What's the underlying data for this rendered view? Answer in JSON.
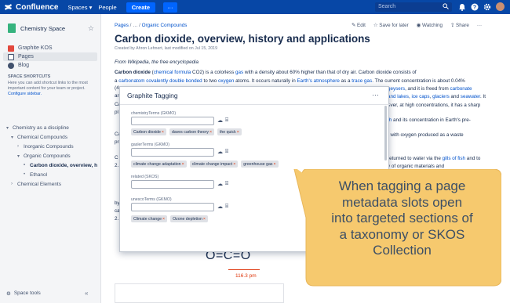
{
  "topbar": {
    "app_name": "Confluence",
    "spaces": "Spaces",
    "spaces_caret": "▾",
    "people": "People",
    "create": "Create",
    "more": "···",
    "search_placeholder": "Search"
  },
  "sidebar": {
    "space_name": "Chemistry Space",
    "items": [
      {
        "label": "Graphite KOS"
      },
      {
        "label": "Pages"
      },
      {
        "label": "Blog"
      }
    ],
    "shortcuts_heading": "SPACE SHORTCUTS",
    "shortcuts_text": "Here you can add shortcut links to the most important content for your team or project.",
    "shortcuts_link": "Configure sidebar.",
    "tree": [
      {
        "label": "Chemistry as a discipline",
        "caret": "▾"
      },
      {
        "label": "Chemical Compounds",
        "caret": "▾"
      },
      {
        "label": "Inorganic Compounds",
        "caret": "›"
      },
      {
        "label": "Organic Compounds",
        "caret": "▾"
      },
      {
        "label": "Carbon dioxide, overview, h",
        "caret": "•"
      },
      {
        "label": "Ethanol",
        "caret": "•"
      },
      {
        "label": "Chemical Elements",
        "caret": "›"
      }
    ],
    "space_tools": "Space tools",
    "collapse": "«"
  },
  "page": {
    "breadcrumb_root": "Pages",
    "breadcrumb_sep": " / … /",
    "breadcrumb_leaf": "Organic Compounds",
    "actions": {
      "edit": "Edit",
      "save": "Save for later",
      "watching": "Watching",
      "share": "Share",
      "more": "···"
    },
    "title": "Carbon dioxide, overview, history and applications",
    "meta": "Created by Ahron Lehnert, last modified on Jul 15, 2019",
    "from": "From Wikipedia, the free encyclopedia",
    "p1": {
      "t1": "Carbon dioxide",
      "t2": " (",
      "l1": "chemical formula",
      "t3": " CO2) is a colorless ",
      "l2": "gas",
      "t4": " with a density about 60% higher than that of dry air. Carbon dioxide consists of"
    },
    "p2": {
      "t0": "a ",
      "l1": "carbonatom covalently double bonded",
      "t1": " to two ",
      "l2": "oxygen",
      "t2": " atoms. It occurs naturally in ",
      "l3": "Earth's atmosphere",
      "t3": " as a ",
      "l4": "trace gas",
      "t4": ". The current concentration is about 0.04%"
    },
    "frag1": {
      "t0": "(4",
      "l1": "geysers",
      "t1": ", and it is freed from ",
      "l2": "carbonate"
    },
    "frag2": {
      "l1": "and lakes",
      "t1": ", ",
      "l2": "ice caps",
      "t2": ", ",
      "l3": "glaciers",
      "t3": " and ",
      "l4": "seawater",
      "t4": ". It"
    },
    "frag3": "ever, at high concentrations, it has a sharp",
    "frag4": {
      "l1": "th",
      "t1": " and its concentration in Earth's pre-"
    },
    "frag5": ", with oxygen produced as a waste",
    "frag6": {
      "t0": "returned to water via the ",
      "l1": "gills of fish",
      "t1": " and to"
    },
    "frag7": "y of organic materials and",
    "frag8": "n",
    "left_frags": [
      "(4",
      "ar",
      "Ca",
      "pl",
      "Ca",
      "pr",
      "C",
      "2.",
      "by",
      "ca",
      "2."
    ],
    "formula": "O=C=O",
    "bond_length": "116.3 pm"
  },
  "dialog": {
    "title": "Graphite Tagging",
    "more": "···",
    "fields": [
      {
        "label": "chemistryTerms (GKMO)",
        "chips": [
          "Carbon dioxide",
          "daves carbon theory",
          "the quick"
        ]
      },
      {
        "label": "gaslerTerms (GKMO)",
        "chips": [
          "climate change adaptation",
          "climate change impact",
          "greenhouse gas"
        ]
      },
      {
        "label": "related (SKOS)",
        "chips": []
      },
      {
        "label": "unescoTerms (GKMO)",
        "chips": [
          "Climate change",
          "Ozone depletion"
        ]
      }
    ],
    "chip_remove": "×",
    "icon_glyphs": [
      "☁",
      "⌸"
    ]
  },
  "callout": {
    "lines": [
      "When tagging a page",
      "metadata slots open",
      "into targeted sections of",
      "a taxonomy or SKOS",
      "Collection"
    ],
    "color": "#f6c96e"
  }
}
